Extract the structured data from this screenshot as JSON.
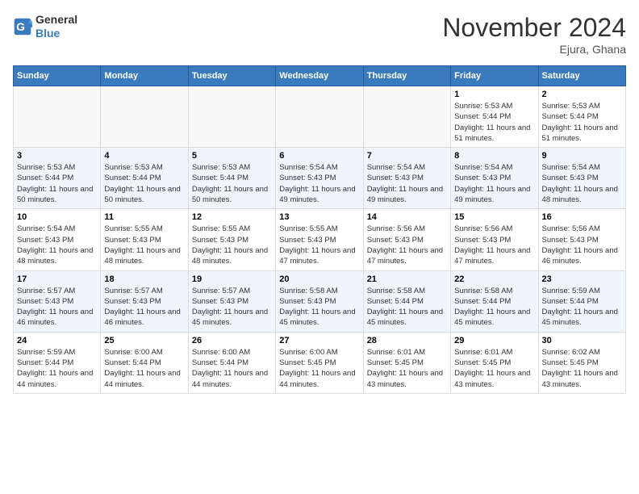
{
  "header": {
    "logo_general": "General",
    "logo_blue": "Blue",
    "month_title": "November 2024",
    "location": "Ejura, Ghana"
  },
  "calendar": {
    "days_of_week": [
      "Sunday",
      "Monday",
      "Tuesday",
      "Wednesday",
      "Thursday",
      "Friday",
      "Saturday"
    ],
    "weeks": [
      [
        {
          "day": "",
          "info": ""
        },
        {
          "day": "",
          "info": ""
        },
        {
          "day": "",
          "info": ""
        },
        {
          "day": "",
          "info": ""
        },
        {
          "day": "",
          "info": ""
        },
        {
          "day": "1",
          "info": "Sunrise: 5:53 AM\nSunset: 5:44 PM\nDaylight: 11 hours and 51 minutes."
        },
        {
          "day": "2",
          "info": "Sunrise: 5:53 AM\nSunset: 5:44 PM\nDaylight: 11 hours and 51 minutes."
        }
      ],
      [
        {
          "day": "3",
          "info": "Sunrise: 5:53 AM\nSunset: 5:44 PM\nDaylight: 11 hours and 50 minutes."
        },
        {
          "day": "4",
          "info": "Sunrise: 5:53 AM\nSunset: 5:44 PM\nDaylight: 11 hours and 50 minutes."
        },
        {
          "day": "5",
          "info": "Sunrise: 5:53 AM\nSunset: 5:44 PM\nDaylight: 11 hours and 50 minutes."
        },
        {
          "day": "6",
          "info": "Sunrise: 5:54 AM\nSunset: 5:43 PM\nDaylight: 11 hours and 49 minutes."
        },
        {
          "day": "7",
          "info": "Sunrise: 5:54 AM\nSunset: 5:43 PM\nDaylight: 11 hours and 49 minutes."
        },
        {
          "day": "8",
          "info": "Sunrise: 5:54 AM\nSunset: 5:43 PM\nDaylight: 11 hours and 49 minutes."
        },
        {
          "day": "9",
          "info": "Sunrise: 5:54 AM\nSunset: 5:43 PM\nDaylight: 11 hours and 48 minutes."
        }
      ],
      [
        {
          "day": "10",
          "info": "Sunrise: 5:54 AM\nSunset: 5:43 PM\nDaylight: 11 hours and 48 minutes."
        },
        {
          "day": "11",
          "info": "Sunrise: 5:55 AM\nSunset: 5:43 PM\nDaylight: 11 hours and 48 minutes."
        },
        {
          "day": "12",
          "info": "Sunrise: 5:55 AM\nSunset: 5:43 PM\nDaylight: 11 hours and 48 minutes."
        },
        {
          "day": "13",
          "info": "Sunrise: 5:55 AM\nSunset: 5:43 PM\nDaylight: 11 hours and 47 minutes."
        },
        {
          "day": "14",
          "info": "Sunrise: 5:56 AM\nSunset: 5:43 PM\nDaylight: 11 hours and 47 minutes."
        },
        {
          "day": "15",
          "info": "Sunrise: 5:56 AM\nSunset: 5:43 PM\nDaylight: 11 hours and 47 minutes."
        },
        {
          "day": "16",
          "info": "Sunrise: 5:56 AM\nSunset: 5:43 PM\nDaylight: 11 hours and 46 minutes."
        }
      ],
      [
        {
          "day": "17",
          "info": "Sunrise: 5:57 AM\nSunset: 5:43 PM\nDaylight: 11 hours and 46 minutes."
        },
        {
          "day": "18",
          "info": "Sunrise: 5:57 AM\nSunset: 5:43 PM\nDaylight: 11 hours and 46 minutes."
        },
        {
          "day": "19",
          "info": "Sunrise: 5:57 AM\nSunset: 5:43 PM\nDaylight: 11 hours and 45 minutes."
        },
        {
          "day": "20",
          "info": "Sunrise: 5:58 AM\nSunset: 5:43 PM\nDaylight: 11 hours and 45 minutes."
        },
        {
          "day": "21",
          "info": "Sunrise: 5:58 AM\nSunset: 5:44 PM\nDaylight: 11 hours and 45 minutes."
        },
        {
          "day": "22",
          "info": "Sunrise: 5:58 AM\nSunset: 5:44 PM\nDaylight: 11 hours and 45 minutes."
        },
        {
          "day": "23",
          "info": "Sunrise: 5:59 AM\nSunset: 5:44 PM\nDaylight: 11 hours and 45 minutes."
        }
      ],
      [
        {
          "day": "24",
          "info": "Sunrise: 5:59 AM\nSunset: 5:44 PM\nDaylight: 11 hours and 44 minutes."
        },
        {
          "day": "25",
          "info": "Sunrise: 6:00 AM\nSunset: 5:44 PM\nDaylight: 11 hours and 44 minutes."
        },
        {
          "day": "26",
          "info": "Sunrise: 6:00 AM\nSunset: 5:44 PM\nDaylight: 11 hours and 44 minutes."
        },
        {
          "day": "27",
          "info": "Sunrise: 6:00 AM\nSunset: 5:45 PM\nDaylight: 11 hours and 44 minutes."
        },
        {
          "day": "28",
          "info": "Sunrise: 6:01 AM\nSunset: 5:45 PM\nDaylight: 11 hours and 43 minutes."
        },
        {
          "day": "29",
          "info": "Sunrise: 6:01 AM\nSunset: 5:45 PM\nDaylight: 11 hours and 43 minutes."
        },
        {
          "day": "30",
          "info": "Sunrise: 6:02 AM\nSunset: 5:45 PM\nDaylight: 11 hours and 43 minutes."
        }
      ]
    ]
  }
}
